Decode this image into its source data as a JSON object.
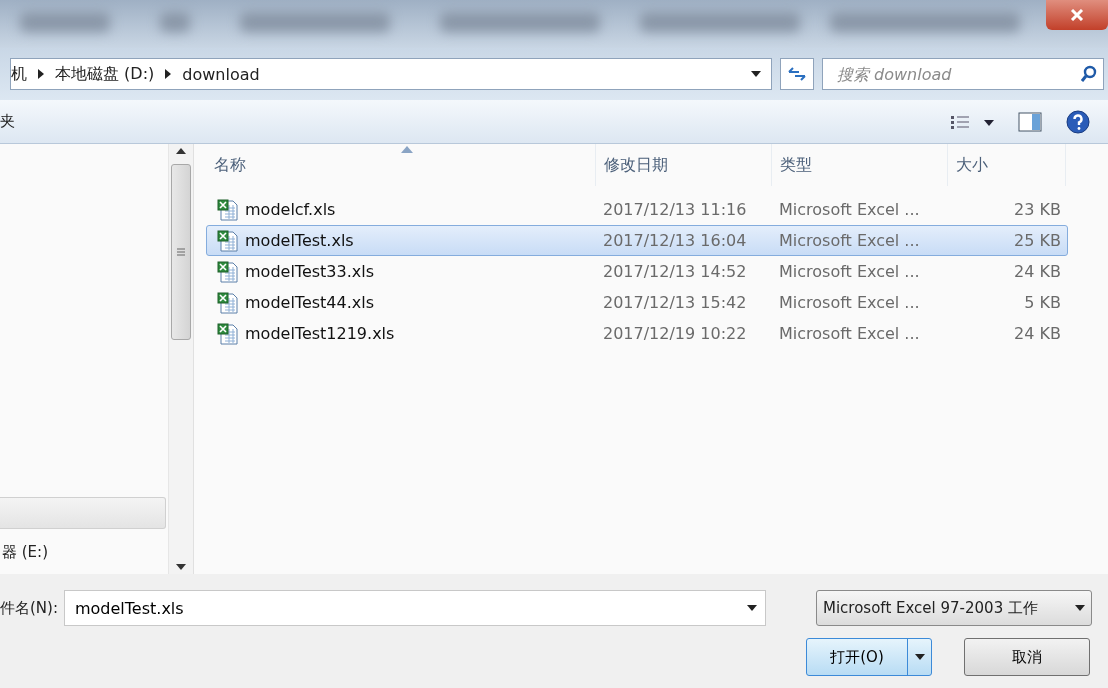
{
  "breadcrumb": [
    "机",
    "本地磁盘 (D:)",
    "download"
  ],
  "search": {
    "placeholder": "搜索 download"
  },
  "toolbar": {
    "label": "夹"
  },
  "sidebar": {
    "items": [
      {
        "label": "器 (E:)"
      }
    ]
  },
  "table": {
    "columns": [
      {
        "label": "名称",
        "sorted": true
      },
      {
        "label": "修改日期",
        "sorted": false
      },
      {
        "label": "类型",
        "sorted": false
      },
      {
        "label": "大小",
        "sorted": false
      }
    ],
    "rows": [
      {
        "name": "modelcf.xls",
        "date": "2017/12/13 11:16",
        "type": "Microsoft Excel ...",
        "size": "23 KB",
        "selected": false
      },
      {
        "name": "modelTest.xls",
        "date": "2017/12/13 16:04",
        "type": "Microsoft Excel ...",
        "size": "25 KB",
        "selected": true
      },
      {
        "name": "modelTest33.xls",
        "date": "2017/12/13 14:52",
        "type": "Microsoft Excel ...",
        "size": "24 KB",
        "selected": false
      },
      {
        "name": "modelTest44.xls",
        "date": "2017/12/13 15:42",
        "type": "Microsoft Excel ...",
        "size": "5 KB",
        "selected": false
      },
      {
        "name": "modelTest1219.xls",
        "date": "2017/12/19 10:22",
        "type": "Microsoft Excel ...",
        "size": "24 KB",
        "selected": false
      }
    ]
  },
  "filename": {
    "label": "件名(N):",
    "value": "modelTest.xls"
  },
  "filetype": {
    "value": "Microsoft Excel 97-2003 工作"
  },
  "buttons": {
    "open": "打开(O)",
    "cancel": "取消"
  }
}
